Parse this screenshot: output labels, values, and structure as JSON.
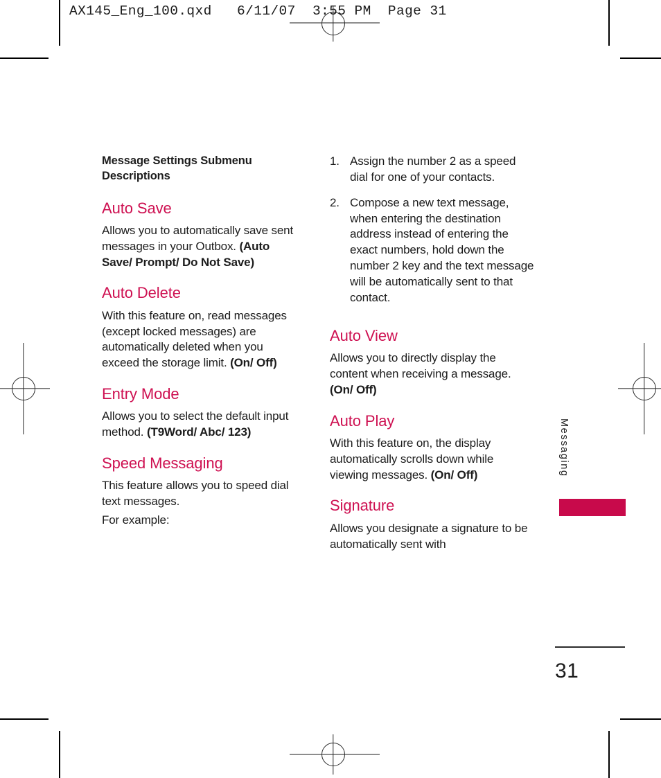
{
  "slug": {
    "text": "AX145_Eng_100.qxd   6/11/07  3:55 PM  Page 31"
  },
  "left_column": {
    "subtitle": "Message Settings Submenu Descriptions",
    "sections": [
      {
        "heading": "Auto Save",
        "body_plain": "Allows you to automatically save sent messages in your Outbox. ",
        "body_bold": "(Auto Save/ Prompt/ Do Not Save)"
      },
      {
        "heading": "Auto Delete",
        "body_plain": "With this feature on, read messages (except locked messages) are automatically deleted when you exceed the storage limit. ",
        "body_bold": "(On/ Off)"
      },
      {
        "heading": "Entry Mode",
        "body_plain": "Allows you to select the default input method. ",
        "body_bold": "(T9Word/ Abc/ 123)"
      },
      {
        "heading": "Speed Messaging",
        "body_plain": "This feature allows you to speed dial text messages.",
        "body_extra": "For example:"
      }
    ]
  },
  "right_column": {
    "steps": [
      {
        "num": "1.",
        "text": "Assign the number 2 as a speed dial for one of your contacts."
      },
      {
        "num": "2.",
        "text": "Compose a new text message, when entering the destination address instead of entering the exact numbers, hold down the number 2 key and the text message will be automatically sent to that contact."
      }
    ],
    "sections": [
      {
        "heading": "Auto View",
        "body_plain": "Allows you to directly display the content when receiving a message. ",
        "body_bold": "(On/ Off)"
      },
      {
        "heading": "Auto Play",
        "body_plain": "With this feature on, the display automatically scrolls down while viewing messages. ",
        "body_bold": "(On/ Off)"
      },
      {
        "heading": "Signature",
        "body_plain": "Allows you designate a signature to be automatically sent with",
        "body_bold": ""
      }
    ]
  },
  "side_tab": {
    "label": "Messaging",
    "color": "#c80a4b"
  },
  "folio": {
    "page_number": "31"
  },
  "colors": {
    "heading": "#ce1051",
    "tab": "#c80a4b",
    "text": "#1c1c1c",
    "trim_rule": "#8d8d8d"
  }
}
